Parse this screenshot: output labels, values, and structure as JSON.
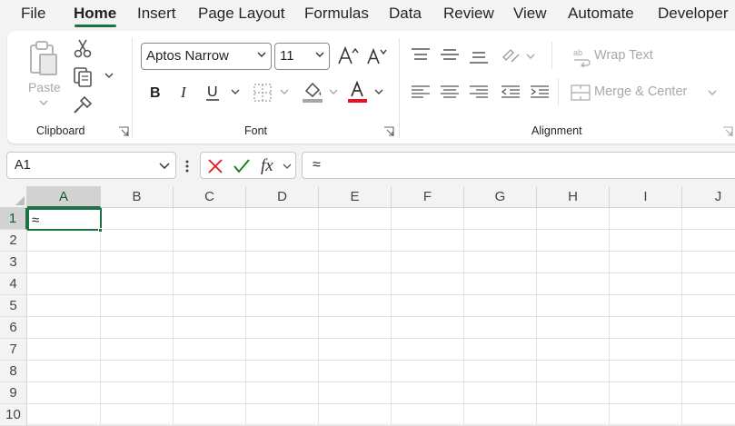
{
  "menu": {
    "tabs": [
      "File",
      "Home",
      "Insert",
      "Page Layout",
      "Formulas",
      "Data",
      "Review",
      "View",
      "Automate",
      "Developer"
    ],
    "active_tab": "Home"
  },
  "ribbon": {
    "clipboard": {
      "label": "Clipboard",
      "paste_label": "Paste"
    },
    "font": {
      "label": "Font",
      "font_name": "Aptos Narrow",
      "font_size": "11"
    },
    "alignment": {
      "label": "Alignment",
      "wrap_text": "Wrap Text",
      "merge_center": "Merge & Center"
    },
    "colors": {
      "accent": "#1e7145",
      "font_color_bar": "#e81123",
      "highlight_bar": "#a6a6a6",
      "cancel": "#e81123",
      "confirm": "#107c10"
    }
  },
  "formula_bar": {
    "name_box": "A1",
    "fx_label": "fx",
    "content": "≈"
  },
  "sheet": {
    "columns": [
      "A",
      "B",
      "C",
      "D",
      "E",
      "F",
      "G",
      "H",
      "I",
      "J"
    ],
    "rows": [
      "1",
      "2",
      "3",
      "4",
      "5",
      "6",
      "7",
      "8",
      "9",
      "10"
    ],
    "active_cell": "A1",
    "a1_value": "≈"
  }
}
